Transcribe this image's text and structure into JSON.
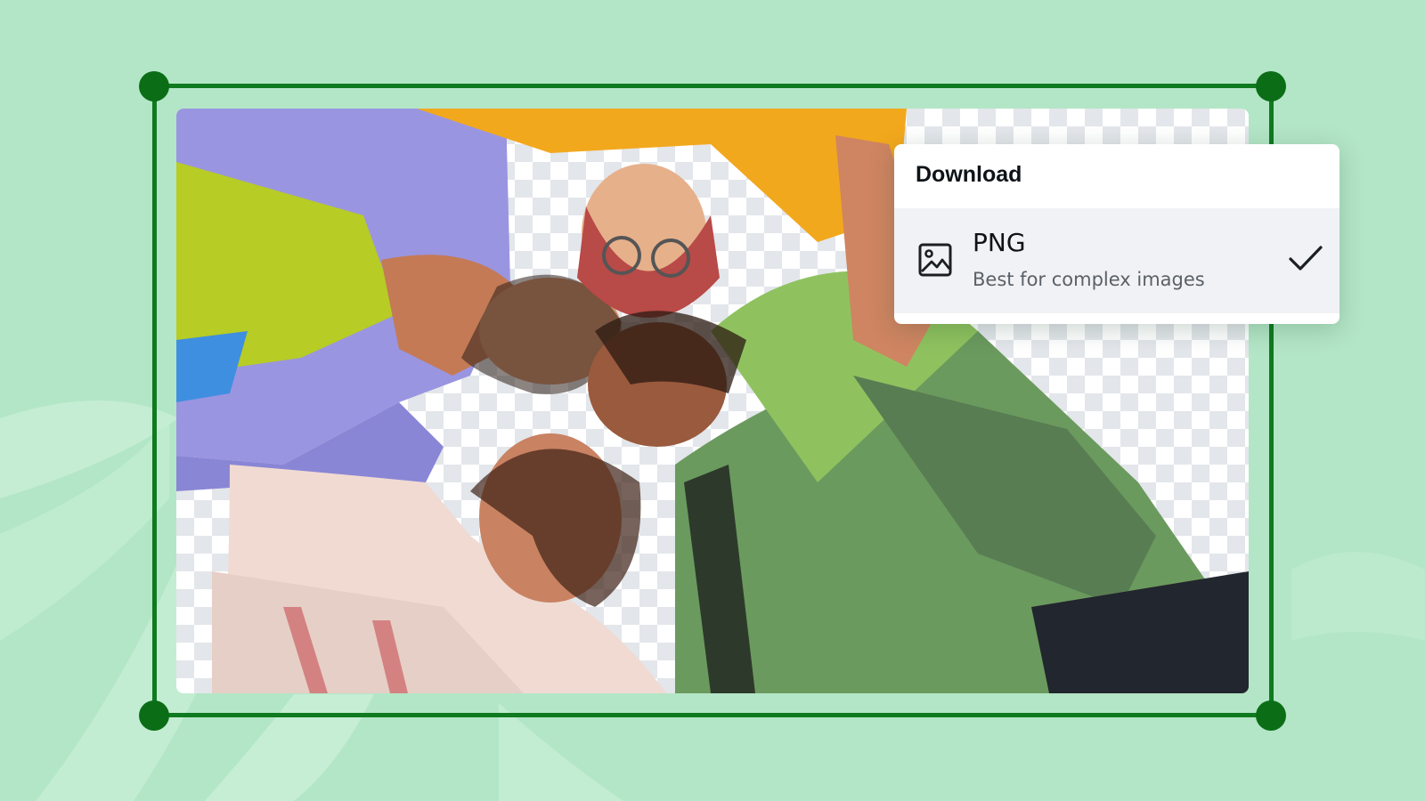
{
  "download_menu": {
    "title": "Download",
    "selected_option": {
      "label": "PNG",
      "description": "Best for complex images",
      "icon": "image-icon",
      "selected": true,
      "check_icon": "checkmark-icon"
    }
  },
  "colors": {
    "background": "#b3e6c6",
    "frame": "#0f7a1f",
    "handle": "#0b6e17",
    "checker": "#e3e6ea"
  }
}
